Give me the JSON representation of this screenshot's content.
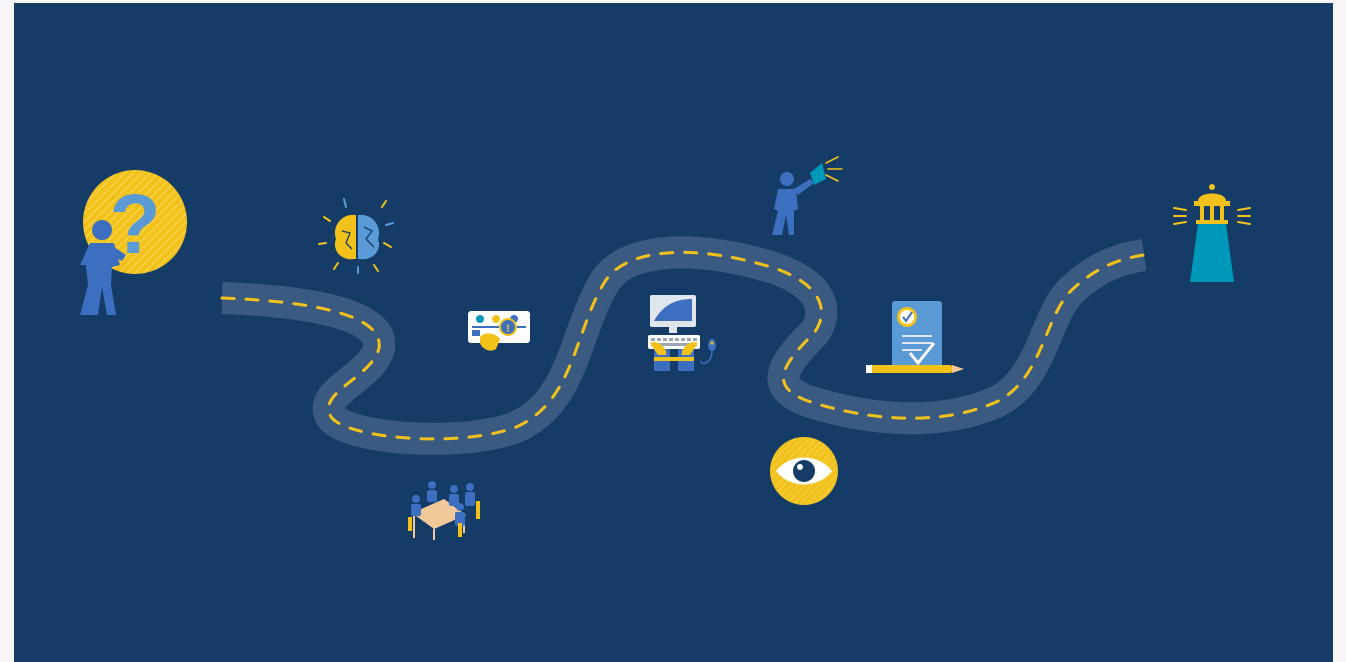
{
  "scene": {
    "background_color": "#143c66",
    "page_background_color": "#f7f5f7",
    "road_color": "#3b5a82",
    "road_dash_color": "#f2c21b",
    "accent_yellow": "#f2c21b",
    "accent_blue": "#3c6fc0",
    "accent_teal": "#0098b8",
    "icons": [
      "person-question-icon",
      "brain-icon",
      "dashboard-pointer-icon",
      "meeting-table-icon",
      "computer-workstation-icon",
      "person-megaphone-icon",
      "eye-icon",
      "checklist-pencil-icon",
      "lighthouse-icon"
    ]
  }
}
